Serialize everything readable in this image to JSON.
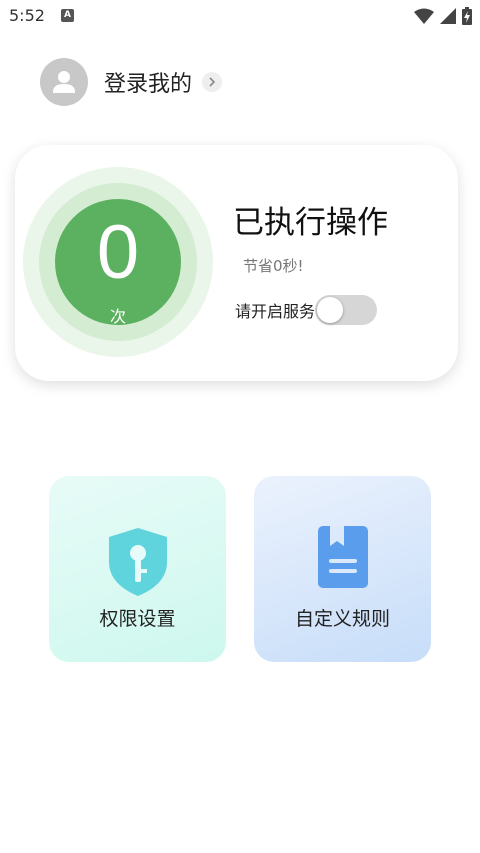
{
  "status_bar": {
    "time": "5:52",
    "notification_glyph": "A",
    "icons": [
      "wifi-icon",
      "signal-icon",
      "battery-icon"
    ]
  },
  "profile": {
    "login_label": "登录我的",
    "icon": "chevron-right-icon"
  },
  "stats": {
    "count": "0",
    "count_unit": "次",
    "title": "已执行操作",
    "saved_text": "节省0秒!",
    "service_label": "请开启服务",
    "service_enabled": false,
    "accent_color": "#5cb161"
  },
  "tiles": [
    {
      "label": "权限设置",
      "icon": "shield-key-icon",
      "color": "#5fd4dc"
    },
    {
      "label": "自定义规则",
      "icon": "bookmark-book-icon",
      "color": "#5a9ded"
    }
  ]
}
